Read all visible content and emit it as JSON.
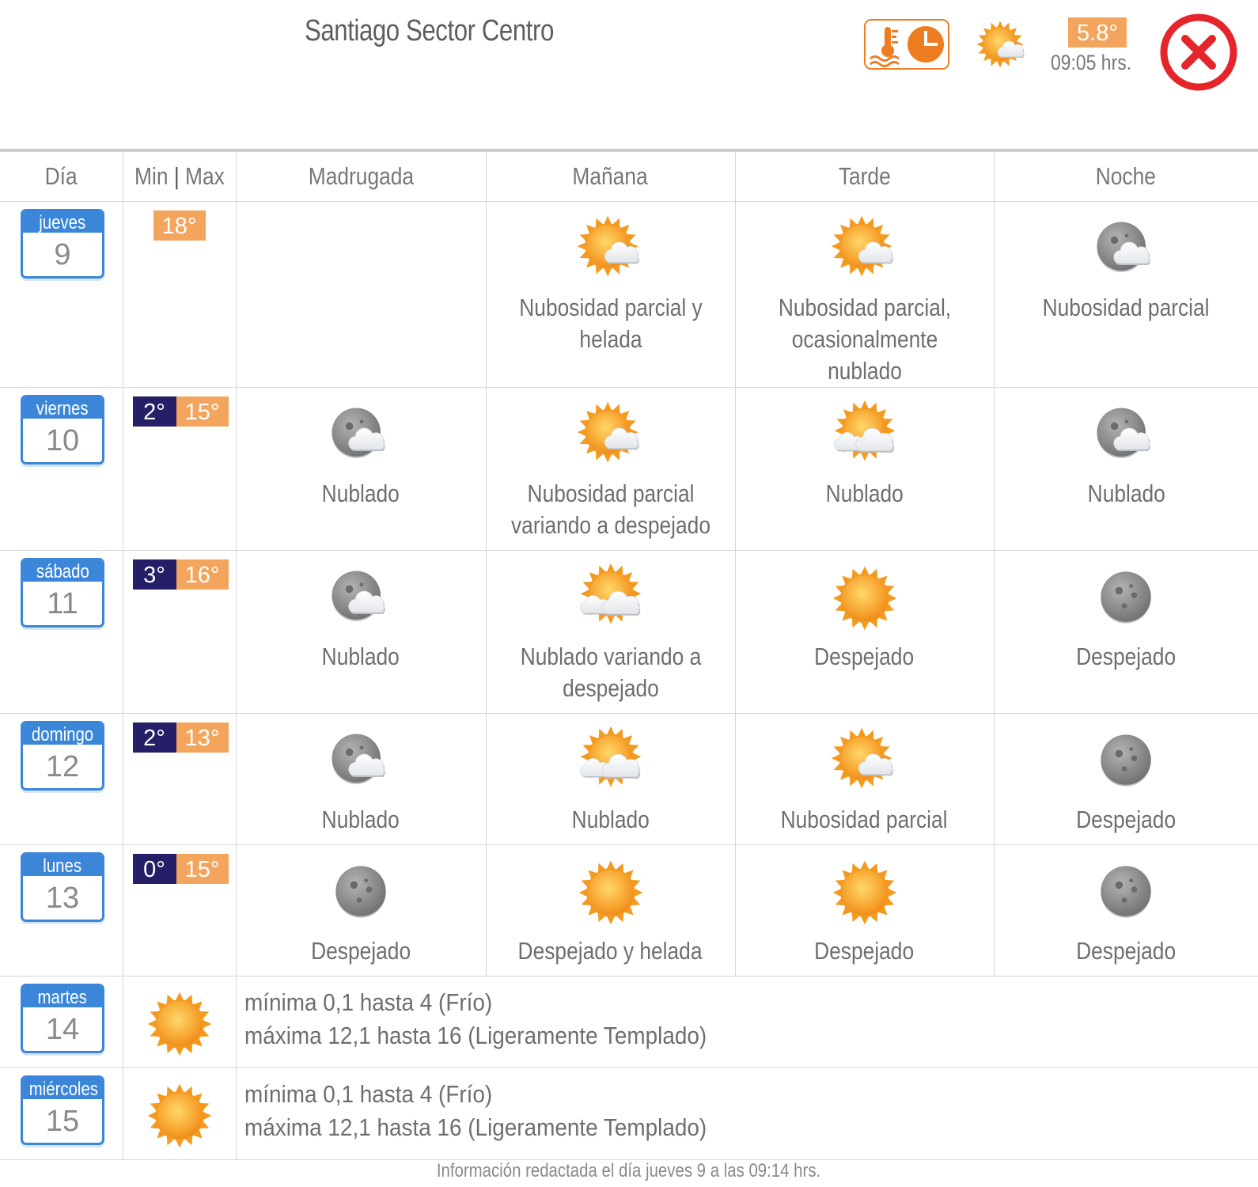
{
  "header": {
    "title": "Santiago Sector Centro",
    "current_temp": "5.8°",
    "current_time": "09:05 hrs.",
    "current_icon": "sun-cloud"
  },
  "table": {
    "headers": [
      "Día",
      "Min",
      "Max",
      "Madrugada",
      "Mañana",
      "Tarde",
      "Noche"
    ]
  },
  "days": [
    {
      "name": "jueves",
      "num": "9",
      "min": "",
      "max": "18°",
      "periods": [
        null,
        {
          "icon": "sun-cloud",
          "text": "Nubosidad parcial y helada"
        },
        {
          "icon": "sun-cloud",
          "text": "Nubosidad parcial, ocasionalmente nublado"
        },
        {
          "icon": "moon-cloud",
          "text": "Nubosidad parcial"
        }
      ]
    },
    {
      "name": "viernes",
      "num": "10",
      "min": "2°",
      "max": "15°",
      "periods": [
        {
          "icon": "moon-cloud",
          "text": "Nublado"
        },
        {
          "icon": "sun-cloud",
          "text": "Nubosidad parcial variando a despejado"
        },
        {
          "icon": "sun-clouds",
          "text": "Nublado"
        },
        {
          "icon": "moon-cloud",
          "text": "Nublado"
        }
      ]
    },
    {
      "name": "sábado",
      "num": "11",
      "min": "3°",
      "max": "16°",
      "periods": [
        {
          "icon": "moon-cloud",
          "text": "Nublado"
        },
        {
          "icon": "sun-clouds",
          "text": "Nublado variando a despejado"
        },
        {
          "icon": "sun",
          "text": "Despejado"
        },
        {
          "icon": "moon",
          "text": "Despejado"
        }
      ]
    },
    {
      "name": "domingo",
      "num": "12",
      "min": "2°",
      "max": "13°",
      "periods": [
        {
          "icon": "moon-cloud",
          "text": "Nublado"
        },
        {
          "icon": "sun-clouds",
          "text": "Nublado"
        },
        {
          "icon": "sun-cloud",
          "text": "Nubosidad parcial"
        },
        {
          "icon": "moon",
          "text": "Despejado"
        }
      ]
    },
    {
      "name": "lunes",
      "num": "13",
      "min": "0°",
      "max": "15°",
      "periods": [
        {
          "icon": "moon",
          "text": "Despejado"
        },
        {
          "icon": "sun",
          "text": "Despejado y helada"
        },
        {
          "icon": "sun",
          "text": "Despejado"
        },
        {
          "icon": "moon",
          "text": "Despejado"
        }
      ]
    }
  ],
  "extended": [
    {
      "name": "martes",
      "num": "14",
      "icon": "sun",
      "line1": "mínima 0,1 hasta 4 (Frío)",
      "line2": "máxima 12,1 hasta 16 (Ligeramente Templado)"
    },
    {
      "name": "miércoles",
      "num": "15",
      "icon": "sun",
      "line1": "mínima 0,1 hasta 4 (Frío)",
      "line2": "máxima 12,1 hasta 16 (Ligeramente Templado)"
    }
  ],
  "footer": "Información redactada el día jueves 9 a las 09:14 hrs.",
  "colors": {
    "accent_blue": "#3b86d9",
    "max_orange": "#f4a55d",
    "min_navy": "#241f66",
    "close_red": "#e4262b",
    "icon_orange": "#ee7d22"
  }
}
